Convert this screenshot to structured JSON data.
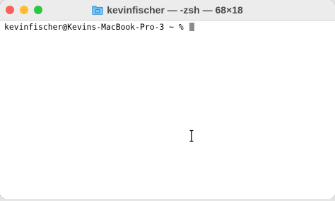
{
  "window": {
    "title": "kevinfischer — -zsh — 68×18",
    "title_icon": "folder-icon"
  },
  "traffic_lights": {
    "close_color": "#fe5f57",
    "minimize_color": "#febc2e",
    "zoom_color": "#28c840"
  },
  "terminal": {
    "prompt": "kevinfischer@Kevins-MacBook-Pro-3 ~ % ",
    "cursor_color": "#8c8c8c",
    "background": "#ffffff",
    "mouse_pointer": "i-beam-cursor-icon"
  }
}
